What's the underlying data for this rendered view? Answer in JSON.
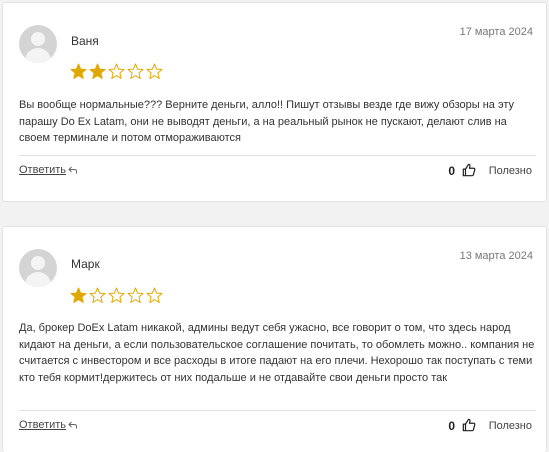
{
  "colors": {
    "star_filled": "#e0a800",
    "star_empty": "#e0a800"
  },
  "reviews": [
    {
      "author": "Ваня",
      "date": "17 марта 2024",
      "rating": 2,
      "max_rating": 5,
      "text": "Вы вообще нормальные??? Верните деньги, алло!! Пишут отзывы везде где вижу обзоры на эту парашу Do Ex Latam, они не выводят деньги, а на реальный рынок не пускают, делают слив на своем терминале и потом отмораживаются",
      "reply_label": "Ответить",
      "likes": "0",
      "useful_label": "Полезно"
    },
    {
      "author": "Марк",
      "date": "13 марта 2024",
      "rating": 1,
      "max_rating": 5,
      "text": "Да, брокер DoEx Latam никакой, админы ведут себя ужасно, все говорит о том, что здесь народ кидают на деньги, а если пользовательское соглашение почитать, то обомлеть можно.. компания не считается с инвестором и все расходы в итоге падают на его плечи. Нехорошо так поступать с теми кто тебя кормит!держитесь от них подальше и не отдавайте свои деньги просто так",
      "reply_label": "Ответить",
      "likes": "0",
      "useful_label": "Полезно"
    }
  ]
}
